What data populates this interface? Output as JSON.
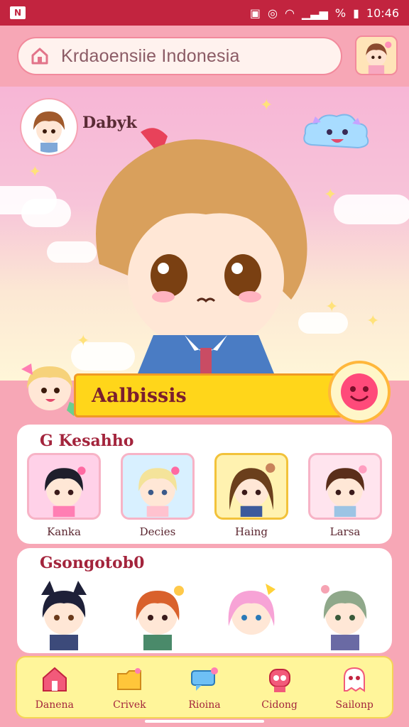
{
  "status_bar": {
    "left_icon": "app-icon",
    "battery_percent": "%",
    "time": "10:46"
  },
  "search": {
    "icon": "home-icon",
    "text": "Krdaoensiie Indonesia"
  },
  "hero": {
    "name": "Dabyk"
  },
  "banner": {
    "title": "Aalbissis"
  },
  "section1": {
    "title": "G Kesahho",
    "characters": [
      {
        "label": "Kanka",
        "bg": "#ffd1e8"
      },
      {
        "label": "Decies",
        "bg": "#d8f0ff"
      },
      {
        "label": "Haing",
        "bg": "#fff2b0"
      },
      {
        "label": "Larsa",
        "bg": "#ffe4ee"
      }
    ]
  },
  "section2": {
    "title": "Gsongotob0",
    "characters": [
      {
        "label": "dark-hair-cat-char"
      },
      {
        "label": "orange-hair-char"
      },
      {
        "label": "pink-hair-char"
      },
      {
        "label": "green-hair-char"
      }
    ]
  },
  "nav": {
    "items": [
      {
        "label": "Danena",
        "icon": "house-icon"
      },
      {
        "label": "Crivek",
        "icon": "folder-icon"
      },
      {
        "label": "Rioina",
        "icon": "chat-icon"
      },
      {
        "label": "Cidong",
        "icon": "robot-icon"
      },
      {
        "label": "Sailonp",
        "icon": "ghost-icon"
      }
    ]
  },
  "colors": {
    "accent": "#c2243f",
    "banner": "#ffd61a",
    "nav_bg": "#fff59a"
  }
}
